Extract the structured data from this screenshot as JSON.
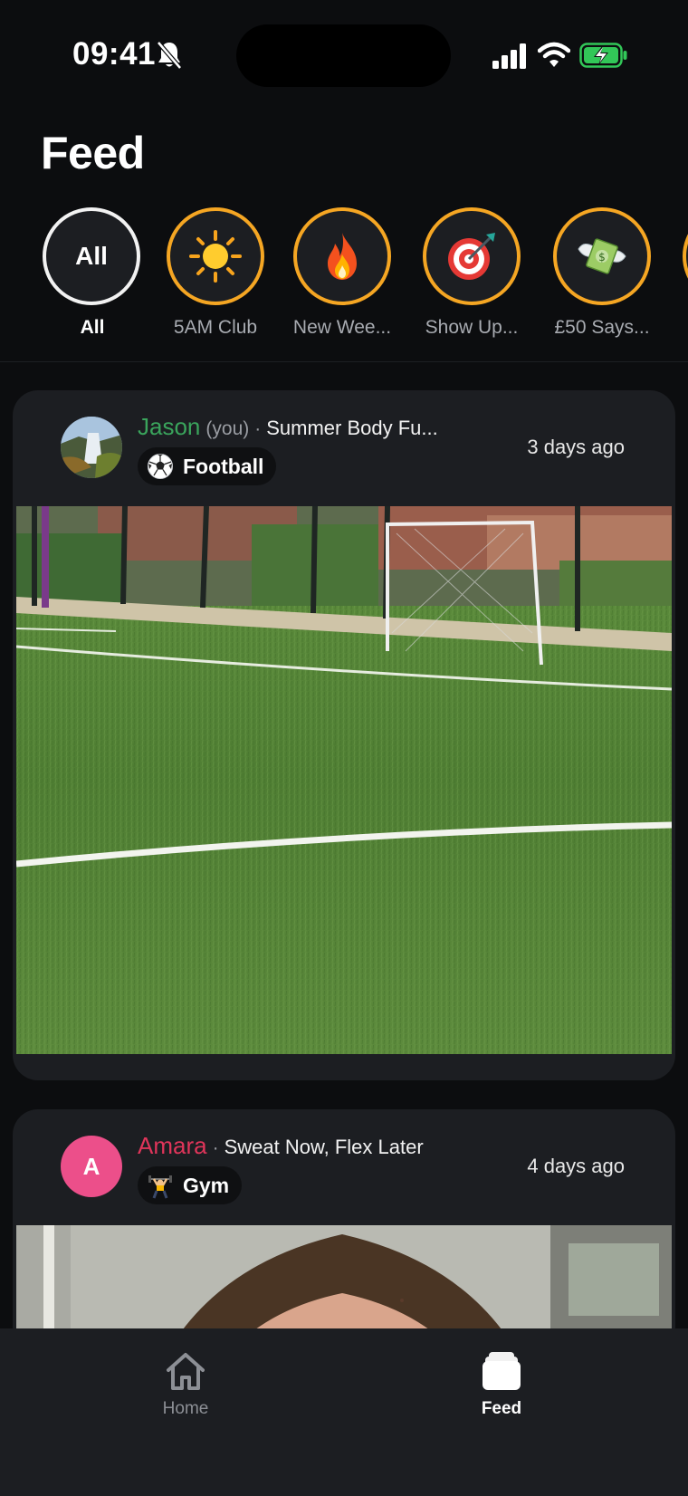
{
  "status_bar": {
    "time": "09:41",
    "icons": [
      "bell-slash-icon",
      "signal-icon",
      "wifi-icon",
      "battery-charging-icon"
    ]
  },
  "header": {
    "title": "Feed"
  },
  "groups": [
    {
      "label": "All",
      "ring_text": "All",
      "icon": "all",
      "active": true
    },
    {
      "label": "5AM Club",
      "icon": "sun-icon",
      "active": false
    },
    {
      "label": "New Wee...",
      "icon": "fire-icon",
      "active": false
    },
    {
      "label": "Show Up...",
      "icon": "target-icon",
      "active": false
    },
    {
      "label": "£50 Says...",
      "icon": "money-wings-icon",
      "active": false
    }
  ],
  "posts": [
    {
      "username": "Jason",
      "you_tag": "(you)",
      "separator": "·",
      "group_name": "Summer Body Fu...",
      "activity": "Football",
      "activity_icon": "soccer-ball-icon",
      "time_ago": "3 days ago",
      "photo": "football pitch photo",
      "username_color": "#3aa45c"
    },
    {
      "username": "Amara",
      "avatar_letter": "A",
      "separator": "·",
      "group_name": "Sweat Now, Flex Later",
      "activity": "Gym",
      "activity_icon": "weightlifter-icon",
      "time_ago": "4 days ago",
      "photo": "face close-up photo",
      "username_color": "#e0355a"
    }
  ],
  "tabbar": {
    "tabs": [
      {
        "label": "Home",
        "icon": "home-icon",
        "active": false
      },
      {
        "label": "Feed",
        "icon": "feed-stack-icon",
        "active": true
      }
    ]
  },
  "colors": {
    "background": "#0c0d0f",
    "card": "#1c1e22",
    "group_ring": "#f5a623",
    "active_ring": "#f2f2f2"
  }
}
